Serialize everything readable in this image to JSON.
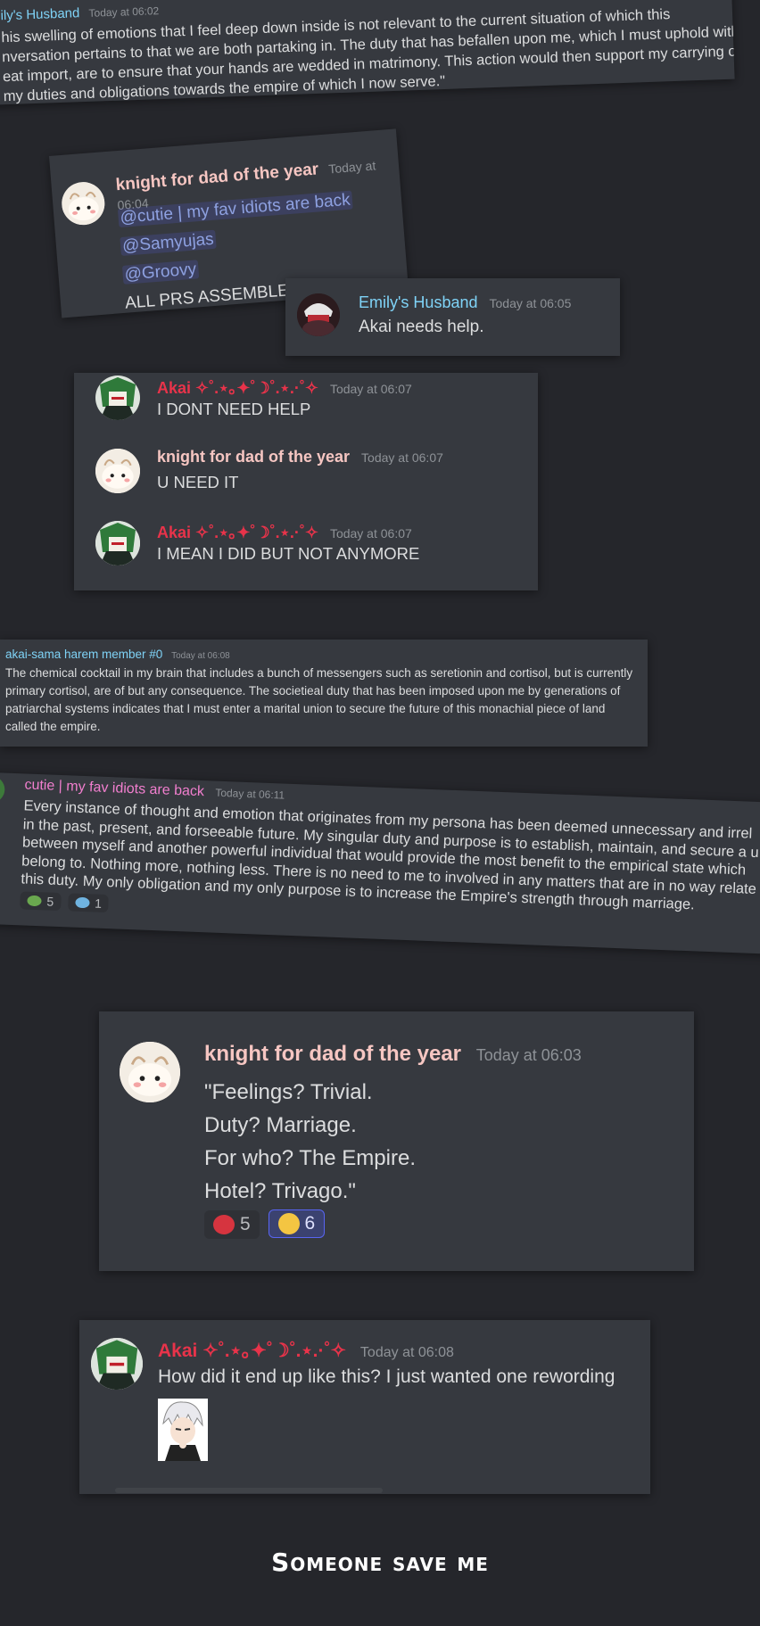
{
  "colors": {
    "background": "#25262b",
    "card": "#36393f",
    "emily_husband": "#7fd3f7",
    "knight": "#f6c6c2",
    "akai": "#e8334a",
    "akai_sama": "#7fd3f7",
    "cutie": "#f27fcf",
    "mention": "#8ea1e1",
    "timestamp": "#8e9297",
    "text": "#dcddde"
  },
  "card1": {
    "author": "ily's Husband",
    "time": "Today at 06:02",
    "lines": [
      "his swelling of emotions that I feel deep down inside is not relevant to the current situation of which this",
      "nversation pertains to that we are both partaking in. The duty that has befallen upon me, which I must uphold with",
      "eat import, are to ensure that your hands are wedded in matrimony. This action would then support my carrying ou",
      "my duties and obligations towards the empire of which I now serve.\""
    ]
  },
  "card2": {
    "author": "knight for dad of the year",
    "time": "Today at 06:04",
    "mentions": [
      "@cutie | my fav idiots are back",
      "@Samyujas",
      "@Groovy"
    ],
    "text": "ALL PRS ASSEMBLE"
  },
  "card3": {
    "author": "Emily's Husband",
    "time": "Today at 06:05",
    "text": "Akai needs help."
  },
  "card4": {
    "messages": [
      {
        "author": "Akai ✧˚.⋆｡✦˚☽˚.⋆.·˚✧",
        "time": "Today at 06:07",
        "text": "I DONT NEED HELP",
        "avatar": "akai-avatar"
      },
      {
        "author": "knight for dad of the year",
        "time": "Today at 06:07",
        "text": "U NEED IT",
        "avatar": "knight-avatar"
      },
      {
        "author": "Akai ✧˚.⋆｡✦˚☽˚.⋆.·˚✧",
        "time": "Today at 06:07",
        "text": "I MEAN I DID BUT NOT ANYMORE",
        "avatar": "akai-avatar"
      }
    ]
  },
  "card5": {
    "author": "akai-sama harem member #0",
    "time": "Today at 06:08",
    "lines": [
      "The chemical cocktail in my brain that includes a bunch of messengers such as seretionin and cortisol, but is currently",
      "primary cortisol, are of but any consequence. The societieal duty that has been imposed upon me by generations of",
      "patriarchal systems indicates that I must enter a marital union to secure the future of this monachial piece of land",
      "called the empire."
    ]
  },
  "card6": {
    "author": "cutie | my fav idiots are back",
    "time": "Today at 06:11",
    "lines": [
      "Every instance of thought and emotion that originates from my persona has been deemed unnecessary and irrel",
      "in the past, present, and forseeable future. My singular duty and purpose is to establish, maintain, and secure a u",
      "between myself and another powerful individual that would provide the most benefit to the empirical state which",
      "belong to. Nothing more, nothing less. There is no need to me to involved in any matters that are in no way relate",
      "this duty. My only obligation and my only purpose is to increase the Empire's strength through marriage."
    ],
    "reactions": [
      {
        "icon": "frog-emoji-icon",
        "count": "5"
      },
      {
        "icon": "fish-emoji-icon",
        "count": "1"
      }
    ]
  },
  "card7": {
    "author": "knight for dad of the year",
    "time": "Today at 06:03",
    "lines": [
      "\"Feelings? Trivial.",
      "Duty? Marriage.",
      "For who? The Empire.",
      "Hotel? Trivago.\""
    ],
    "reactions": [
      {
        "icon": "heart-emoji-icon",
        "count": "5"
      },
      {
        "icon": "crying-emoji-icon",
        "count": "6"
      }
    ]
  },
  "card8": {
    "author": "Akai ✧˚.⋆｡✦˚☽˚.⋆.·˚✧",
    "time": "Today at 06:08",
    "text": "How did it end up like this? I just wanted one rewording"
  },
  "caption": "Someone save me"
}
